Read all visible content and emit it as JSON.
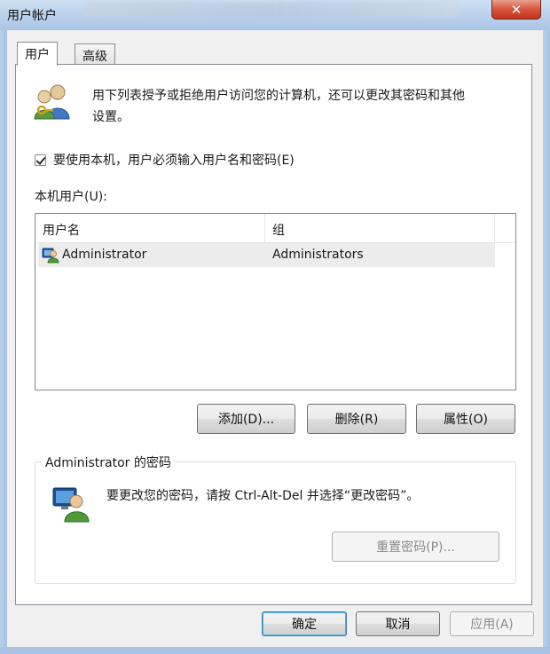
{
  "window": {
    "title": "用户帐户",
    "close_glyph": "✕"
  },
  "tabs": [
    {
      "label": "用户",
      "active": true
    },
    {
      "label": "高级",
      "active": false
    }
  ],
  "intro": {
    "icon": "users-keys-icon",
    "text_line1": "用下列表授予或拒绝用户访问您的计算机，还可以更改其密码和其他",
    "text_line2": "设置。"
  },
  "require_login": {
    "checked": true,
    "label": "要使用本机，用户必须输入用户名和密码(E)"
  },
  "local_users_label": "本机用户(U):",
  "users_table": {
    "columns": [
      "用户名",
      "组"
    ],
    "rows": [
      {
        "name": "Administrator",
        "group": "Administrators",
        "icon": "admin-user-icon"
      }
    ]
  },
  "actions": {
    "add": "添加(D)...",
    "remove": "删除(R)",
    "properties": "属性(O)"
  },
  "password_group": {
    "title": "Administrator 的密码",
    "icon": "user-monitor-icon",
    "text": "要更改您的密码，请按 Ctrl-Alt-Del 并选择“更改密码”。",
    "reset_button": "重置密码(P)..."
  },
  "footer": {
    "ok": "确定",
    "cancel": "取消",
    "apply": "应用(A)"
  },
  "colors": {
    "titlebar": "#bcd3ec",
    "close": "#d7553d",
    "default_button_border": "#3c7fb1"
  }
}
